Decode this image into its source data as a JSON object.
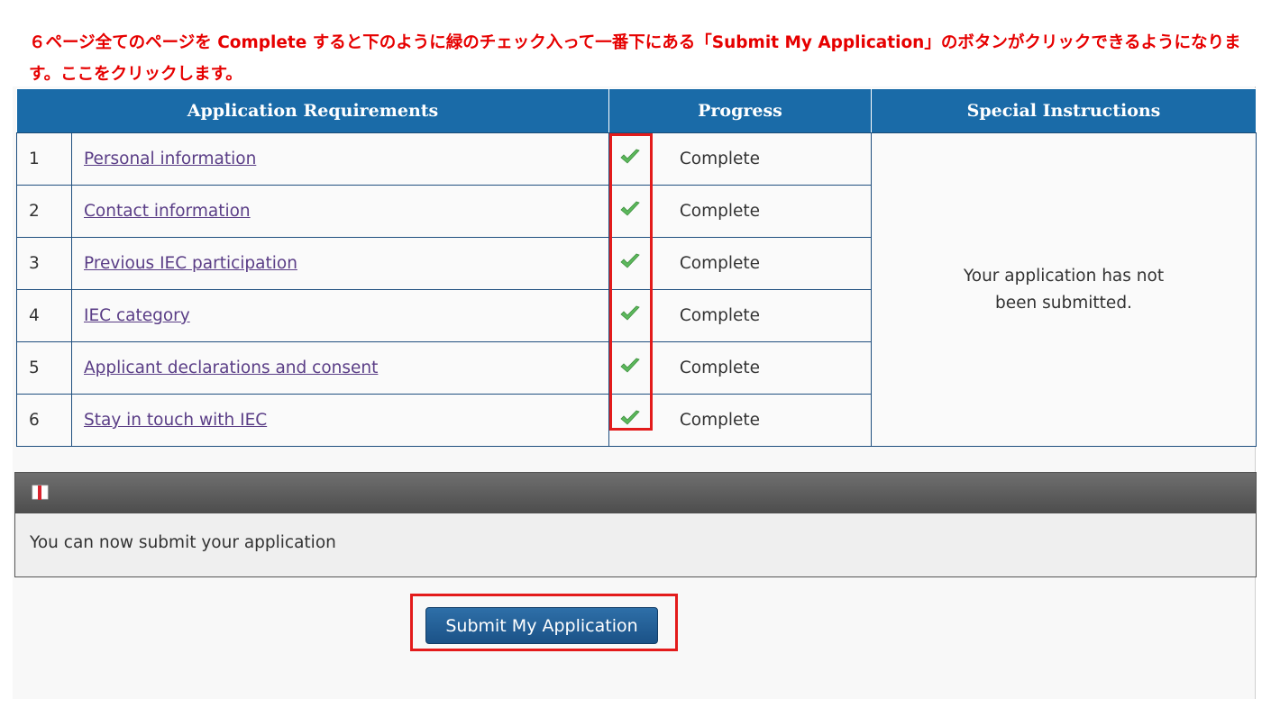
{
  "annotation": {
    "text": "６ページ全てのページを Complete すると下のように緑のチェック入って一番下にある「Submit My Application」のボタンがクリックできるようになります。ここをクリックします。"
  },
  "table": {
    "headers": {
      "requirements": "Application Requirements",
      "progress": "Progress",
      "special": "Special Instructions"
    },
    "rows": [
      {
        "num": "1",
        "name": "Personal information",
        "status": "Complete"
      },
      {
        "num": "2",
        "name": "Contact information",
        "status": "Complete"
      },
      {
        "num": "3",
        "name": "Previous IEC participation",
        "status": "Complete"
      },
      {
        "num": "4",
        "name": "IEC category",
        "status": "Complete"
      },
      {
        "num": "5",
        "name": "Applicant declarations and consent",
        "status": "Complete"
      },
      {
        "num": "6",
        "name": "Stay in touch with IEC",
        "status": "Complete"
      }
    ],
    "special_text": "Your application has not been submitted."
  },
  "notice": {
    "icon": "book-icon",
    "text": "You can now submit your application"
  },
  "submit": {
    "label": "Submit My Application"
  },
  "colors": {
    "header_bg": "#1a6ba8",
    "annotation_red": "#e60000",
    "check_green": "#5cb85c",
    "button_bg": "#1b5287"
  }
}
